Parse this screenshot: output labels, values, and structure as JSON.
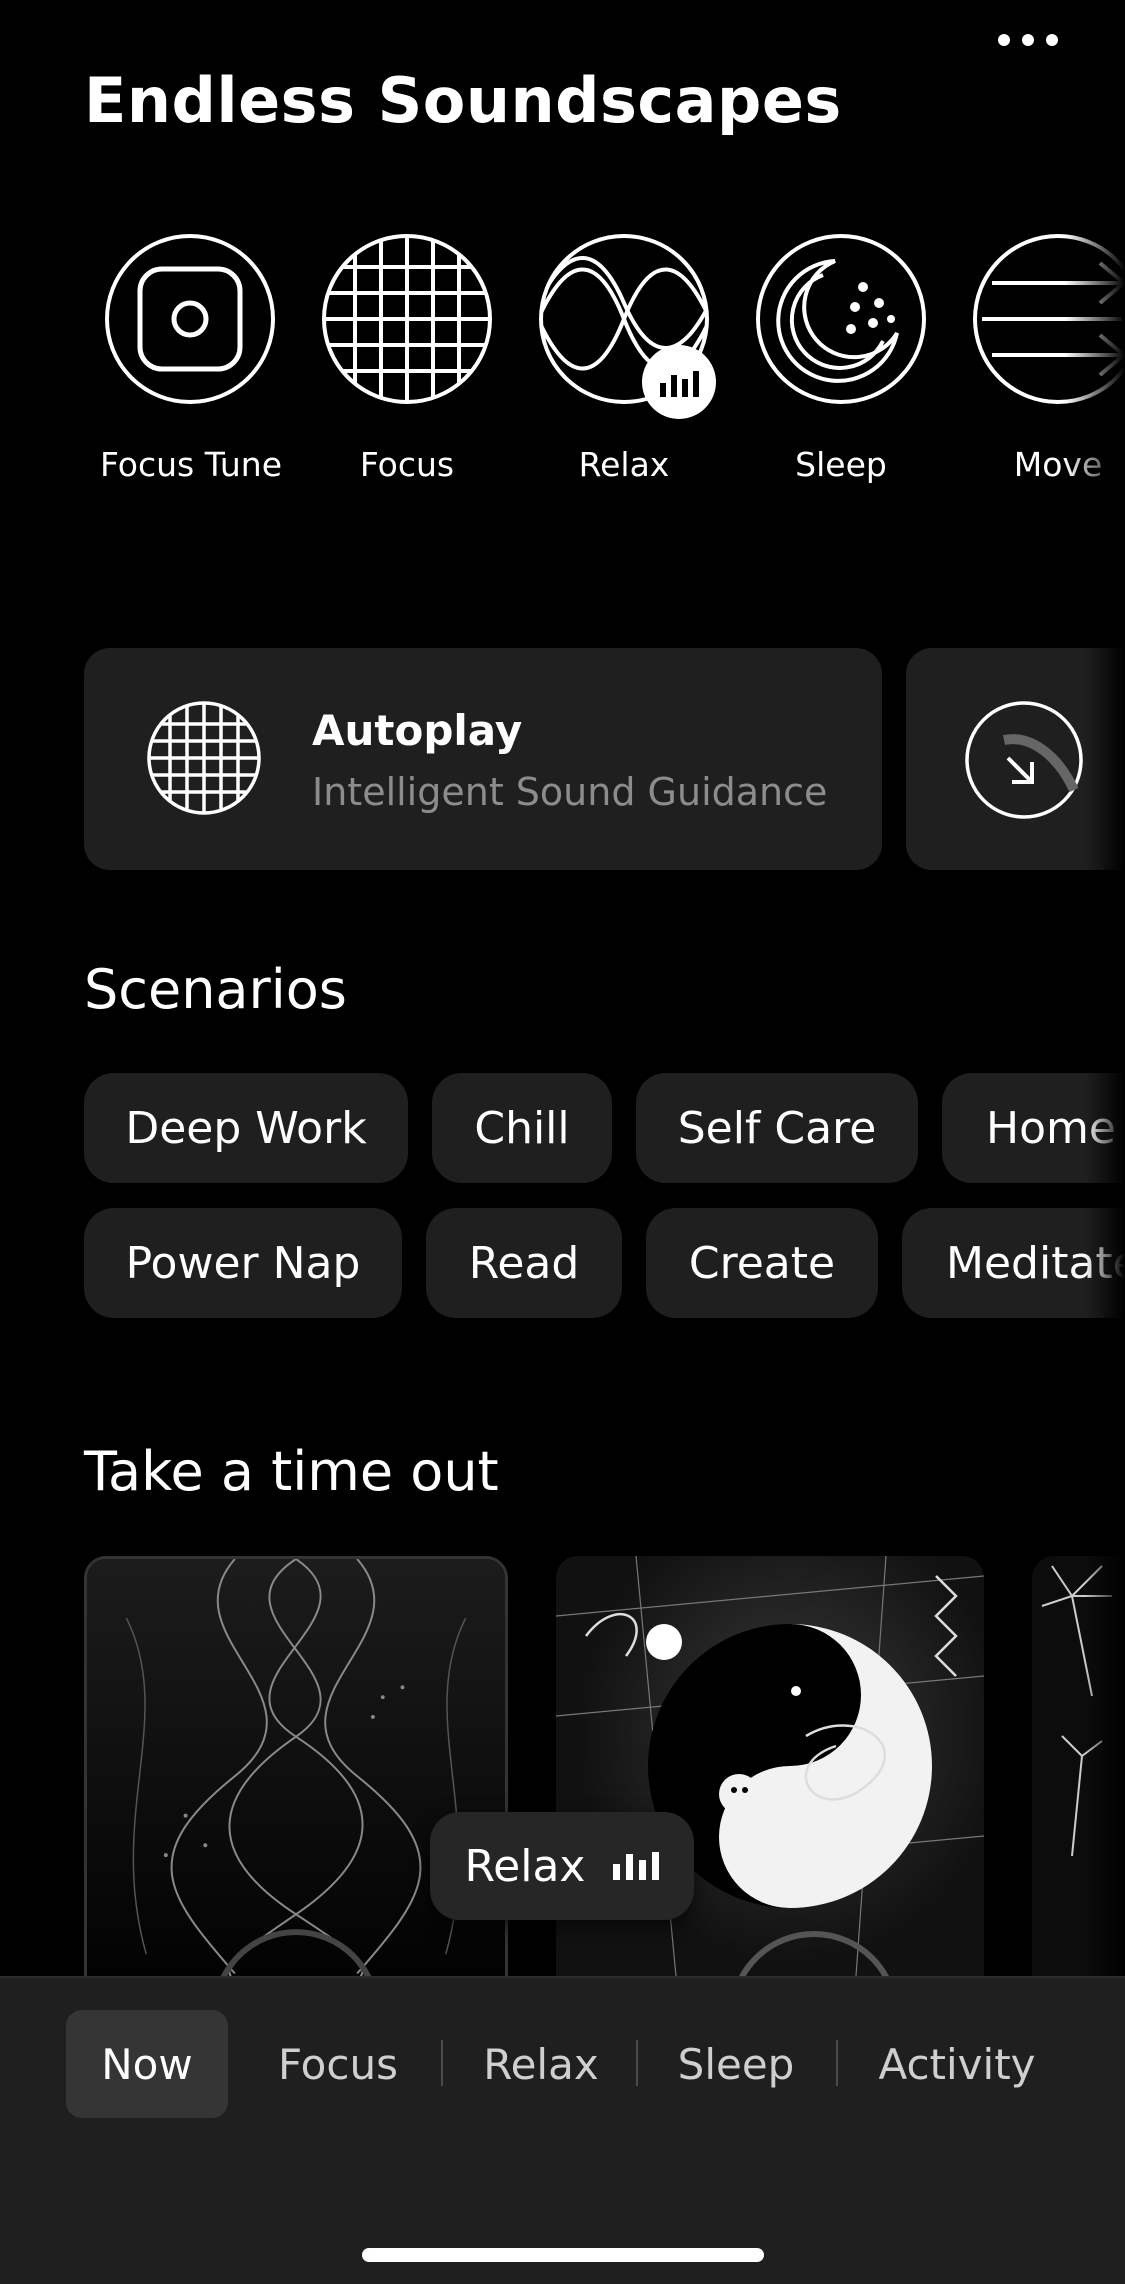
{
  "header": {
    "title": "Endless Soundscapes"
  },
  "modes": [
    {
      "label": "Focus Tune",
      "icon": "focus-tune-icon"
    },
    {
      "label": "Focus",
      "icon": "grid-globe-icon"
    },
    {
      "label": "Relax",
      "icon": "wave-icon",
      "playing": true
    },
    {
      "label": "Sleep",
      "icon": "moon-icon"
    },
    {
      "label": "Move",
      "icon": "arrows-right-icon"
    }
  ],
  "autoplay": {
    "title": "Autoplay",
    "subtitle": "Intelligent Sound Guidance"
  },
  "scenarios": {
    "title": "Scenarios",
    "row1": [
      "Deep Work",
      "Chill",
      "Self Care",
      "Home"
    ],
    "row2": [
      "Power Nap",
      "Read",
      "Create",
      "Meditate"
    ]
  },
  "timeout": {
    "title": "Take a time out"
  },
  "now_playing": {
    "label": "Relax"
  },
  "tabs": [
    {
      "label": "Now",
      "active": true
    },
    {
      "label": "Focus"
    },
    {
      "label": "Relax"
    },
    {
      "label": "Sleep"
    },
    {
      "label": "Activity"
    }
  ],
  "colors": {
    "background": "#000000",
    "surface": "#1f1f1f",
    "text": "#ffffff",
    "muted": "#8c8c8c"
  }
}
